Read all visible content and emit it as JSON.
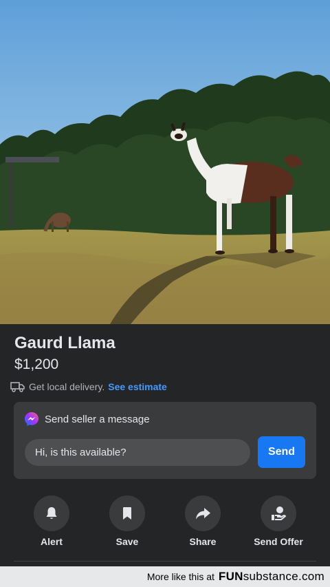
{
  "listing": {
    "title": "Gaurd Llama",
    "price": "$1,200"
  },
  "delivery": {
    "text": "Get local delivery.",
    "link": "See estimate",
    "icon": "truck-icon"
  },
  "message": {
    "header": "Send seller a message",
    "input_value": "Hi, is this available?",
    "send_label": "Send",
    "icon": "messenger-icon"
  },
  "actions": [
    {
      "label": "Alert",
      "icon": "bell-icon"
    },
    {
      "label": "Save",
      "icon": "bookmark-icon"
    },
    {
      "label": "Share",
      "icon": "share-arrow-icon"
    },
    {
      "label": "Send Offer",
      "icon": "offer-hand-icon"
    }
  ],
  "watermark": {
    "text": "More like this at",
    "brand_bold": "FUN",
    "brand_rest": "substance",
    "brand_tld": ".com"
  },
  "colors": {
    "background": "#242526",
    "card": "#3a3b3c",
    "accent": "#1877f2",
    "link": "#4599ff"
  }
}
